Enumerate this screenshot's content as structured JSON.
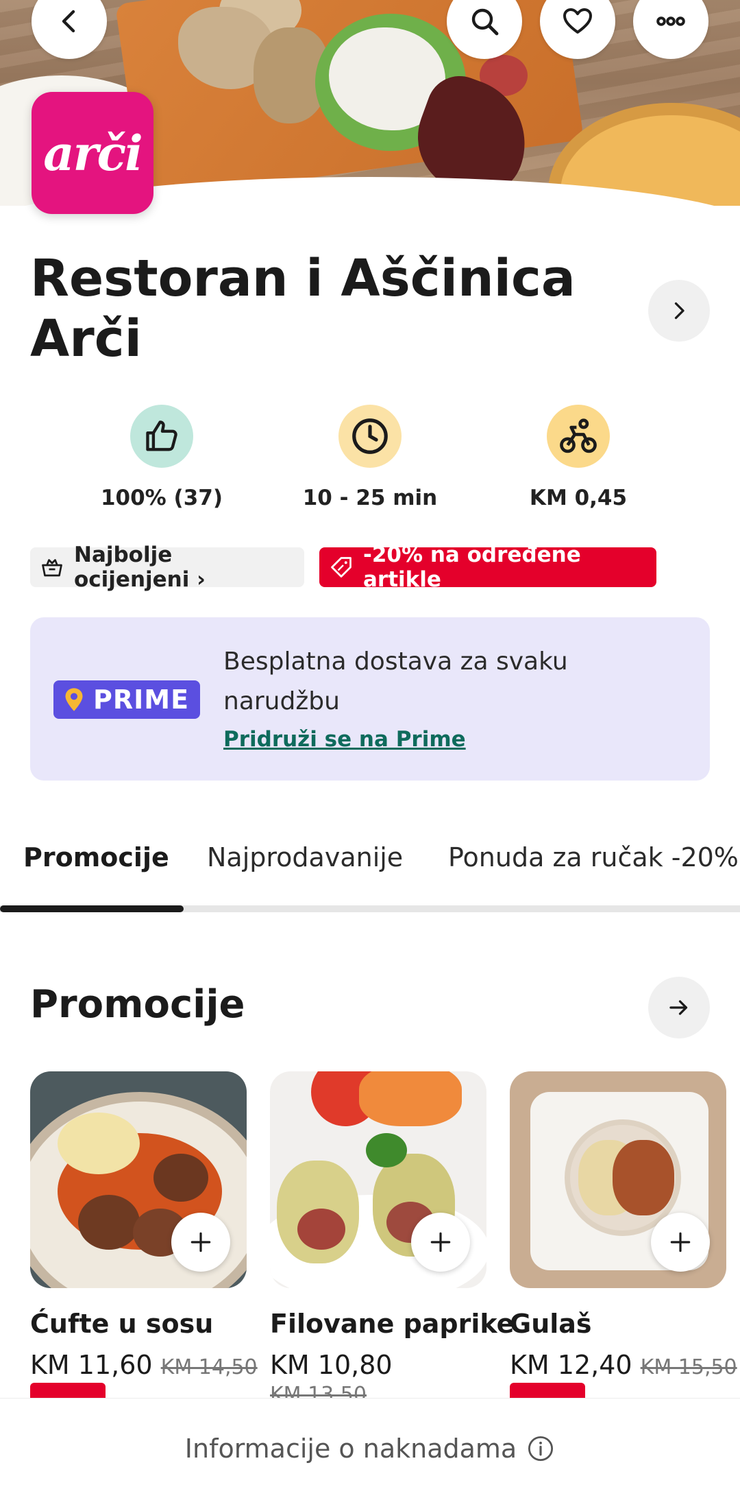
{
  "header": {
    "back_icon": "chevron-left-icon",
    "search_icon": "search-icon",
    "favorite_icon": "heart-icon",
    "more_icon": "more-horizontal-icon"
  },
  "restaurant": {
    "logo_text": "arči",
    "name": "Restoran i Aščinica Arči",
    "brand_color": "#e4147f"
  },
  "stats": {
    "rating": "100% (37)",
    "delivery_time": "10 - 25 min",
    "delivery_fee": "KM 0,45"
  },
  "tags": {
    "top_rated": "Najbolje ocijenjeni ›",
    "discount": "-20% na određene artikle"
  },
  "prime": {
    "badge": "PRIME",
    "text": "Besplatna dostava za svaku narudžbu",
    "link": "Pridruži se na Prime"
  },
  "tabs": [
    {
      "label": "Promocije",
      "active": true
    },
    {
      "label": "Najprodavanije",
      "active": false
    },
    {
      "label": "Ponuda za ručak -20%",
      "active": false
    }
  ],
  "section": {
    "title": "Promocije"
  },
  "products": [
    {
      "name": "Ćufte u sosu",
      "price": "KM 11,60",
      "old_price": "KM 14,50"
    },
    {
      "name": "Filovane paprike",
      "price": "KM 10,80",
      "old_price": "KM 13,50"
    },
    {
      "name": "Gulaš",
      "price": "KM 12,40",
      "old_price": "KM 15,50"
    }
  ],
  "footer": {
    "text": "Informacije o naknadama"
  },
  "colors": {
    "accent_red": "#e4002b",
    "prime_purple": "#5b4fe0",
    "prime_bg": "#e9e7fa",
    "link_green": "#0e6b5c"
  }
}
